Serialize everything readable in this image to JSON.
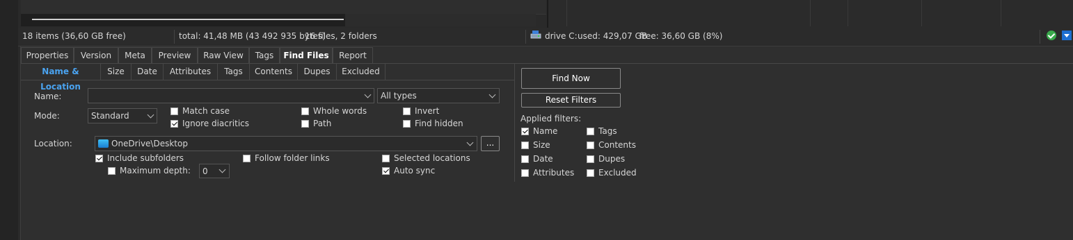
{
  "statusbar": {
    "items": "18 items (36,60 GB free)",
    "total": "total: 41,48 MB (43 492 935 bytes)",
    "files": "16 files, 2 folders",
    "drive": "drive C:",
    "used": "used: 429,07 GB",
    "free": "free: 36,60 GB (8%)"
  },
  "tabs": [
    "Properties",
    "Version",
    "Meta",
    "Preview",
    "Raw View",
    "Tags",
    "Find Files",
    "Report"
  ],
  "subtabs": [
    "Name & Location",
    "Size",
    "Date",
    "Attributes",
    "Tags",
    "Contents",
    "Dupes",
    "Excluded"
  ],
  "form": {
    "name_label": "Name:",
    "name_value": "",
    "type_value": "All types",
    "mode_label": "Mode:",
    "mode_value": "Standard",
    "match_case": "Match case",
    "ignore_diacritics": "Ignore diacritics",
    "whole_words": "Whole words",
    "path": "Path",
    "invert": "Invert",
    "find_hidden": "Find hidden",
    "location_label": "Location:",
    "location_value": "OneDrive\\Desktop",
    "browse": "...",
    "include_subfolders": "Include subfolders",
    "follow_links": "Follow folder links",
    "selected_locations": "Selected locations",
    "max_depth": "Maximum depth:",
    "max_depth_value": "0",
    "auto_sync": "Auto sync"
  },
  "actions": {
    "find_now": "Find Now",
    "reset_filters": "Reset Filters",
    "applied_filters": "Applied filters:"
  },
  "filters": {
    "name": "Name",
    "size": "Size",
    "date": "Date",
    "attributes": "Attributes",
    "tags": "Tags",
    "contents": "Contents",
    "dupes": "Dupes",
    "excluded": "Excluded"
  },
  "colors": {
    "active_subtab": "#4aa3f0",
    "ok_green": "#39a84b",
    "dropdown_blue": "#1e6fd0"
  },
  "icons": [
    "drive-icon",
    "ok-icon",
    "dropdown-icon",
    "onedrive-icon",
    "chevron-down-icon"
  ]
}
